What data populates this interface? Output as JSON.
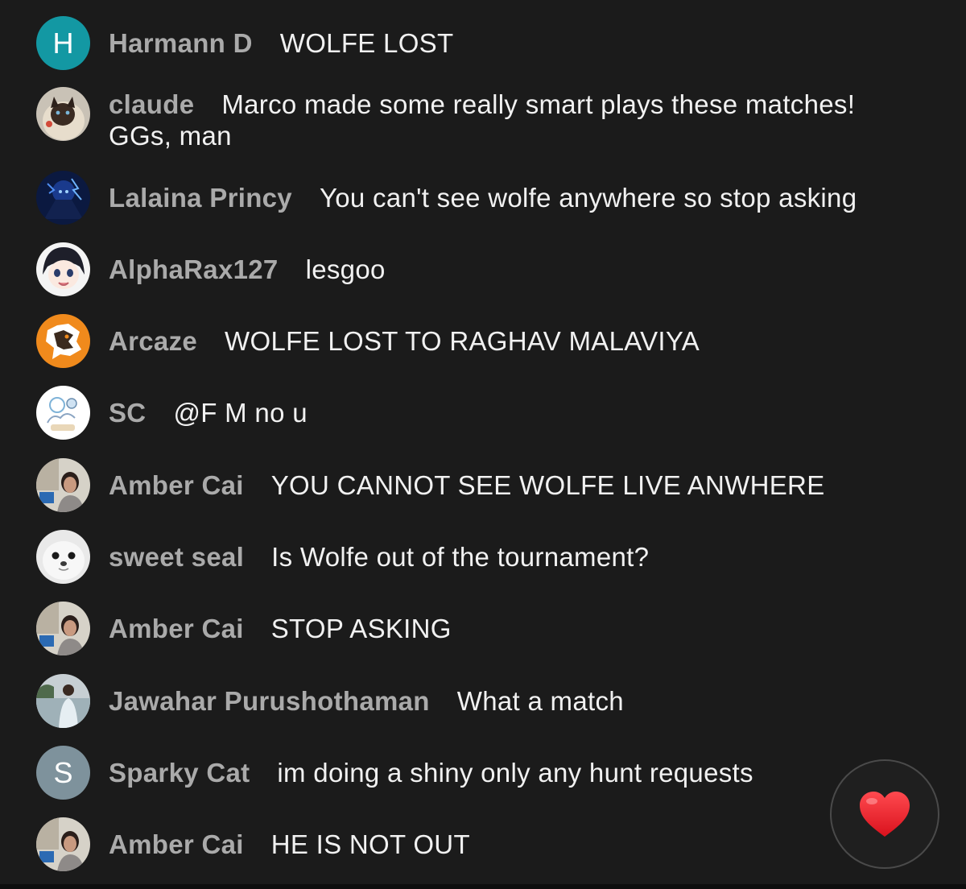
{
  "chat": {
    "messages": [
      {
        "author": "Harmann D",
        "text": "WOLFE LOST",
        "avatar": {
          "type": "letter",
          "letter": "H",
          "color": "#1398a3"
        }
      },
      {
        "author": "claude",
        "text": "Marco made some really smart plays these matches! GGs, man",
        "avatar": {
          "type": "image",
          "icon": "siamese-cat-photo"
        }
      },
      {
        "author": "Lalaina Princy",
        "text": "You can't see wolfe anywhere so stop asking",
        "avatar": {
          "type": "image",
          "icon": "blue-anime-character"
        }
      },
      {
        "author": "AlphaRax127",
        "text": "lesgoo",
        "avatar": {
          "type": "image",
          "icon": "anime-girl"
        }
      },
      {
        "author": "Arcaze",
        "text": "WOLFE LOST TO RAGHAV MALAVIYA",
        "avatar": {
          "type": "image",
          "icon": "orange-wolf-logo"
        }
      },
      {
        "author": "SC",
        "text": "@F M no u",
        "avatar": {
          "type": "image",
          "icon": "doodle-sketch"
        }
      },
      {
        "author": "Amber Cai",
        "text": "YOU CANNOT SEE WOLFE LIVE ANWHERE",
        "avatar": {
          "type": "image",
          "icon": "person-photo"
        }
      },
      {
        "author": "sweet seal",
        "text": "Is Wolfe out of the tournament?",
        "avatar": {
          "type": "image",
          "icon": "seal-photo"
        }
      },
      {
        "author": "Amber Cai",
        "text": "STOP ASKING",
        "avatar": {
          "type": "image",
          "icon": "person-photo"
        }
      },
      {
        "author": "Jawahar Purushothaman",
        "text": "What a match",
        "avatar": {
          "type": "image",
          "icon": "beach-person-photo"
        }
      },
      {
        "author": "Sparky Cat",
        "text": "im doing a shiny only any hunt requests",
        "avatar": {
          "type": "letter",
          "letter": "S",
          "color": "#7e929c"
        }
      },
      {
        "author": "Amber Cai",
        "text": "HE IS NOT OUT",
        "avatar": {
          "type": "image",
          "icon": "person-photo"
        }
      }
    ]
  },
  "reaction_button": {
    "icon": "heart-icon",
    "color": "#e8202a"
  },
  "colors": {
    "background": "#1b1b1b",
    "author": "#aaaaaa",
    "message": "#f1f1f1"
  }
}
